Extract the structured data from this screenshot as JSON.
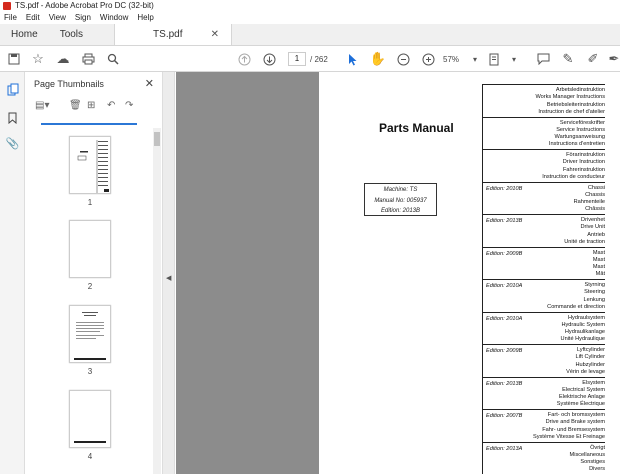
{
  "window": {
    "title": "TS.pdf - Adobe Acrobat Pro DC (32-bit)"
  },
  "menu": [
    "File",
    "Edit",
    "View",
    "Sign",
    "Window",
    "Help"
  ],
  "tabs": {
    "home": "Home",
    "tools": "Tools",
    "doc": "TS.pdf"
  },
  "toolbar": {
    "page_current": "1",
    "page_total": "/ 262",
    "zoom": "57%"
  },
  "panel": {
    "title": "Page Thumbnails",
    "thumbnails": [
      "1",
      "2",
      "3",
      "4"
    ]
  },
  "document": {
    "title": "Parts Manual",
    "machine": "Machine: TS",
    "manual_no": "Manual No: 005937",
    "edition": "Edition: 2013B",
    "sections": [
      {
        "edition": "",
        "lines": [
          "Arbetsledinstruktion",
          "Works Manager Instructions",
          "Betriebsleiterinstruktion",
          "Instruction de chef d'atelier"
        ]
      },
      {
        "edition": "",
        "lines": [
          "Serviceföreskrifter",
          "Service Instructions",
          "Wartungsanweisung",
          "Instructions d'entretien"
        ]
      },
      {
        "edition": "",
        "lines": [
          "Förarinstruktion",
          "Driver Instruction",
          "Fahrerinstruktion",
          "Instruction de conducteur"
        ]
      },
      {
        "edition": "Edition: 2010B",
        "lines": [
          "Chassi",
          "Chassis",
          "Rahmenteile",
          "Châssis"
        ]
      },
      {
        "edition": "Edition: 2013B",
        "lines": [
          "Drivenhet",
          "Drive Unit",
          "Antrieb",
          "Unité de traction"
        ]
      },
      {
        "edition": "Edition: 2009B",
        "lines": [
          "Mast",
          "Mast",
          "Mast",
          "Mât"
        ]
      },
      {
        "edition": "Edition: 2010A",
        "lines": [
          "Styrning",
          "Steering",
          "Lenkung",
          "Commande et direction"
        ]
      },
      {
        "edition": "Edition: 2010A",
        "lines": [
          "Hydraulsystem",
          "Hydraulic System",
          "Hydraulikanlage",
          "Unité Hydraulique"
        ]
      },
      {
        "edition": "Edition: 2009B",
        "lines": [
          "Lyftcylinder",
          "Lift Cylinder",
          "Hubzylinder",
          "Vérin de levage"
        ]
      },
      {
        "edition": "Edition: 2013B",
        "lines": [
          "Elsystem",
          "Electrical System",
          "Elektrische Anlage",
          "Système Électrique"
        ]
      },
      {
        "edition": "Edition: 2007B",
        "lines": [
          "Fart- och bromssystem",
          "Drive and Brake system",
          "Fahr- und Bremsesystem",
          "Système Vitesse Et Freinage"
        ]
      },
      {
        "edition": "Edition: 2013A",
        "lines": [
          "Övrigt",
          "Miscellaneous",
          "Sonstiges",
          "Divers"
        ]
      }
    ]
  }
}
